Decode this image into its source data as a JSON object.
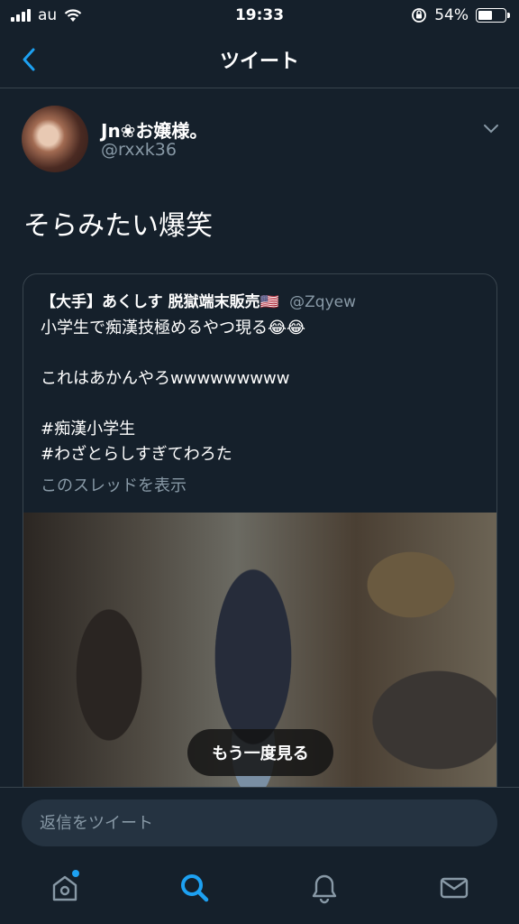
{
  "status_bar": {
    "carrier": "au",
    "time": "19:33",
    "battery_percent": "54%",
    "battery_level": 0.54
  },
  "nav": {
    "title": "ツイート",
    "back_icon": "chevron-left-icon"
  },
  "tweet": {
    "user_name": "Jn❀お嬢様。",
    "handle": "@rxxk36",
    "text": "そらみたい爆笑",
    "menu_icon": "chevron-down-icon",
    "quoted": {
      "name": "【大手】あくしす 脱獄端末販売🇺🇸",
      "handle": "@Zqyew",
      "lines": [
        "小学生で痴漢技極めるやつ現る😂😂",
        "",
        "これはあかんやろwwwwwwwww",
        "",
        "#痴漢小学生",
        "#わざとらしすぎてわろた"
      ],
      "thread_link": "このスレッドを表示",
      "video_button": "もう一度見る"
    }
  },
  "reply": {
    "placeholder": "返信をツイート"
  },
  "tab_bar": {
    "items": [
      {
        "icon": "home-icon",
        "active": false,
        "badge": true
      },
      {
        "icon": "search-icon",
        "active": true,
        "badge": false
      },
      {
        "icon": "bell-icon",
        "active": false,
        "badge": false
      },
      {
        "icon": "mail-icon",
        "active": false,
        "badge": false
      }
    ],
    "accent": "#1da1f2",
    "muted": "#8899a6"
  }
}
